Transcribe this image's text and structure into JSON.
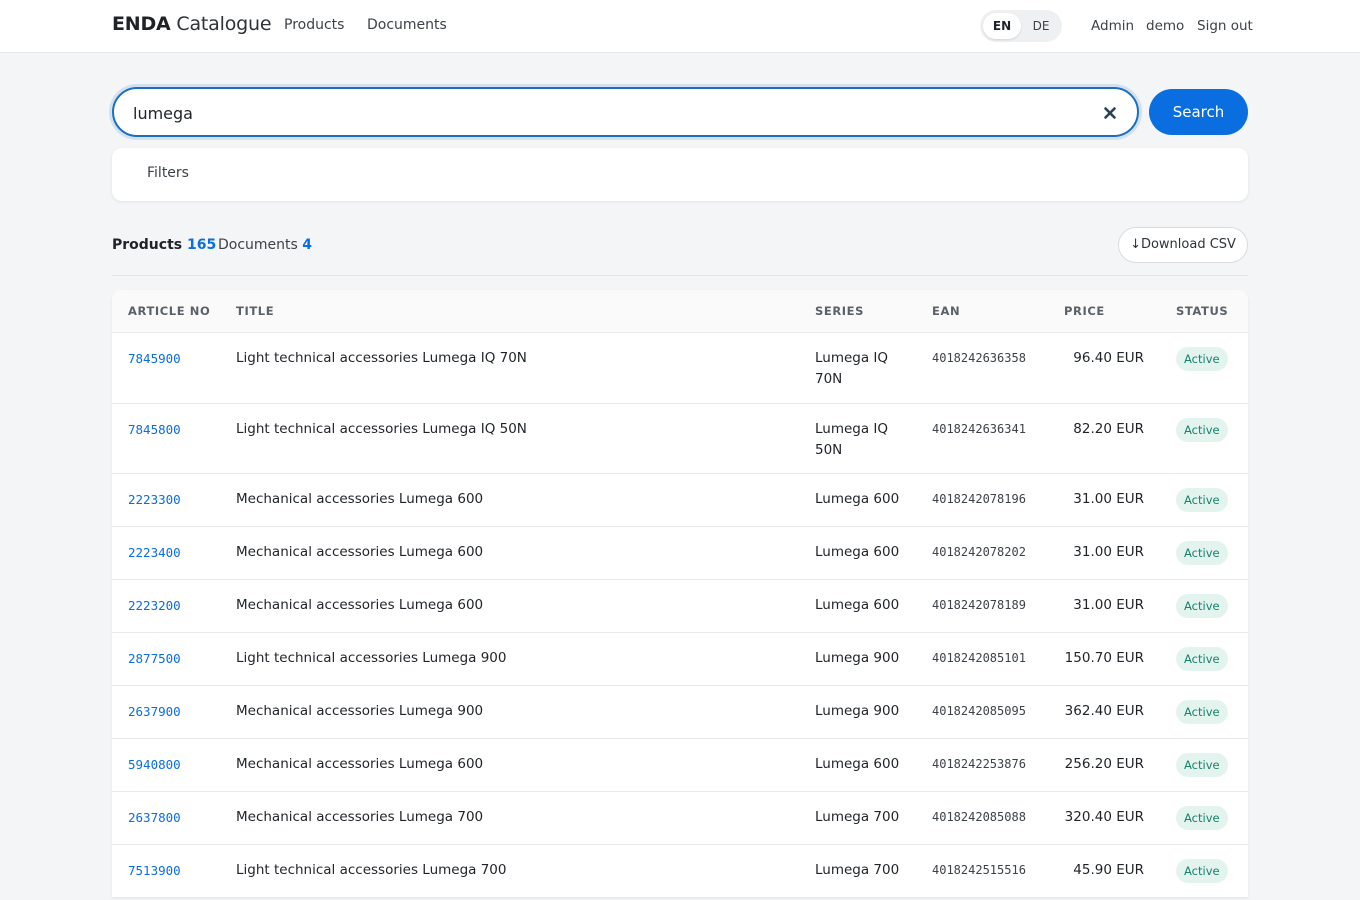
{
  "header": {
    "brand_bold": "ENDA",
    "brand_rest": "Catalogue",
    "nav": [
      "Products",
      "Documents"
    ],
    "languages": [
      "EN",
      "DE"
    ],
    "active_language": "EN",
    "user_links": [
      "Admin",
      "demo",
      "Sign out"
    ]
  },
  "search": {
    "value": "lumega",
    "placeholder": "",
    "button_label": "Search"
  },
  "filters": {
    "label": "Filters"
  },
  "tabs": {
    "products_label": "Products",
    "products_count": "165",
    "documents_label": "Documents",
    "documents_count": "4",
    "csv_label": "↓Download CSV"
  },
  "table": {
    "headers": [
      "ARTICLE NO",
      "TITLE",
      "SERIES",
      "EAN",
      "PRICE",
      "STATUS"
    ],
    "rows": [
      {
        "article": "7845900",
        "title": "Light technical accessories Lumega IQ 70N",
        "series": "Lumega IQ 70N",
        "ean": "4018242636358",
        "price": "96.40 EUR",
        "status": "Active"
      },
      {
        "article": "7845800",
        "title": "Light technical accessories Lumega IQ 50N",
        "series": "Lumega IQ 50N",
        "ean": "4018242636341",
        "price": "82.20 EUR",
        "status": "Active"
      },
      {
        "article": "2223300",
        "title": "Mechanical accessories Lumega 600",
        "series": "Lumega 600",
        "ean": "4018242078196",
        "price": "31.00 EUR",
        "status": "Active"
      },
      {
        "article": "2223400",
        "title": "Mechanical accessories Lumega 600",
        "series": "Lumega 600",
        "ean": "4018242078202",
        "price": "31.00 EUR",
        "status": "Active"
      },
      {
        "article": "2223200",
        "title": "Mechanical accessories Lumega 600",
        "series": "Lumega 600",
        "ean": "4018242078189",
        "price": "31.00 EUR",
        "status": "Active"
      },
      {
        "article": "2877500",
        "title": "Light technical accessories Lumega 900",
        "series": "Lumega 900",
        "ean": "4018242085101",
        "price": "150.70 EUR",
        "status": "Active"
      },
      {
        "article": "2637900",
        "title": "Mechanical accessories Lumega 900",
        "series": "Lumega 900",
        "ean": "4018242085095",
        "price": "362.40 EUR",
        "status": "Active"
      },
      {
        "article": "5940800",
        "title": "Mechanical accessories Lumega 600",
        "series": "Lumega 600",
        "ean": "4018242253876",
        "price": "256.20 EUR",
        "status": "Active"
      },
      {
        "article": "2637800",
        "title": "Mechanical accessories Lumega 700",
        "series": "Lumega 700",
        "ean": "4018242085088",
        "price": "320.40 EUR",
        "status": "Active"
      },
      {
        "article": "7513900",
        "title": "Light technical accessories Lumega 700",
        "series": "Lumega 700",
        "ean": "4018242515516",
        "price": "45.90 EUR",
        "status": "Active"
      }
    ]
  },
  "colors": {
    "accent": "#0b6ee0",
    "active_badge_bg": "#e3f4ef",
    "active_badge_text": "#17806b"
  },
  "icons": {
    "clear": "close-icon",
    "download": "download-arrow"
  }
}
